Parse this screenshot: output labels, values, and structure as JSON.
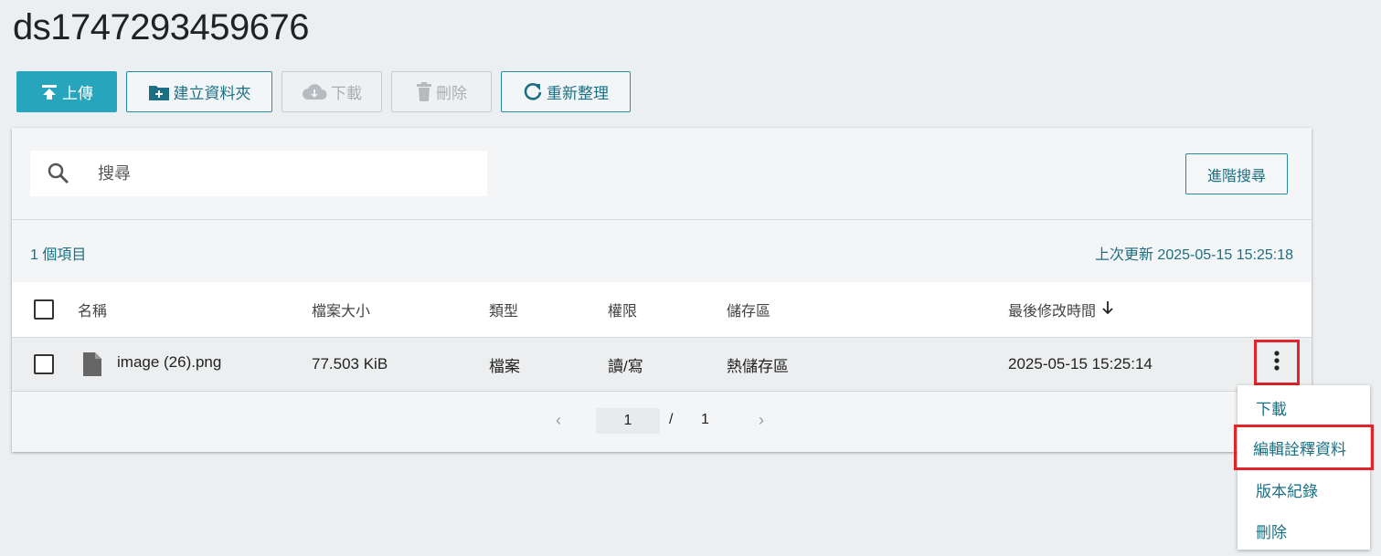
{
  "page": {
    "title": "ds1747293459676"
  },
  "toolbar": {
    "upload_label": "上傳",
    "new_folder_label": "建立資料夾",
    "download_label": "下載",
    "delete_label": "刪除",
    "refresh_label": "重新整理"
  },
  "search": {
    "placeholder": "搜尋",
    "advanced_label": "進階搜尋"
  },
  "summary": {
    "count_label": "1 個項目",
    "updated_label": "上次更新 2025-05-15 15:25:18"
  },
  "table": {
    "headers": {
      "name": "名稱",
      "size": "檔案大小",
      "type": "類型",
      "permission": "權限",
      "storage": "儲存區",
      "modified": "最後修改時間"
    },
    "rows": [
      {
        "name": "image (26).png",
        "size": "77.503 KiB",
        "type": "檔案",
        "permission": "讀/寫",
        "storage": "熱儲存區",
        "modified": "2025-05-15 15:25:14"
      }
    ]
  },
  "pagination": {
    "current": "1",
    "separator": "/",
    "total": "1"
  },
  "context_menu": {
    "items": [
      "下載",
      "編輯詮釋資料",
      "版本紀錄",
      "刪除"
    ]
  },
  "colors": {
    "accent": "#27a5bd",
    "link": "#1c6f83",
    "highlight": "#e0242b"
  },
  "icons": {
    "upload": "upload-icon",
    "folder": "folder-plus-icon",
    "download": "cloud-download-icon",
    "delete": "trash-icon",
    "refresh": "refresh-icon",
    "search": "search-icon",
    "file": "file-icon",
    "sort": "arrow-down-icon",
    "more": "more-vertical-icon"
  }
}
